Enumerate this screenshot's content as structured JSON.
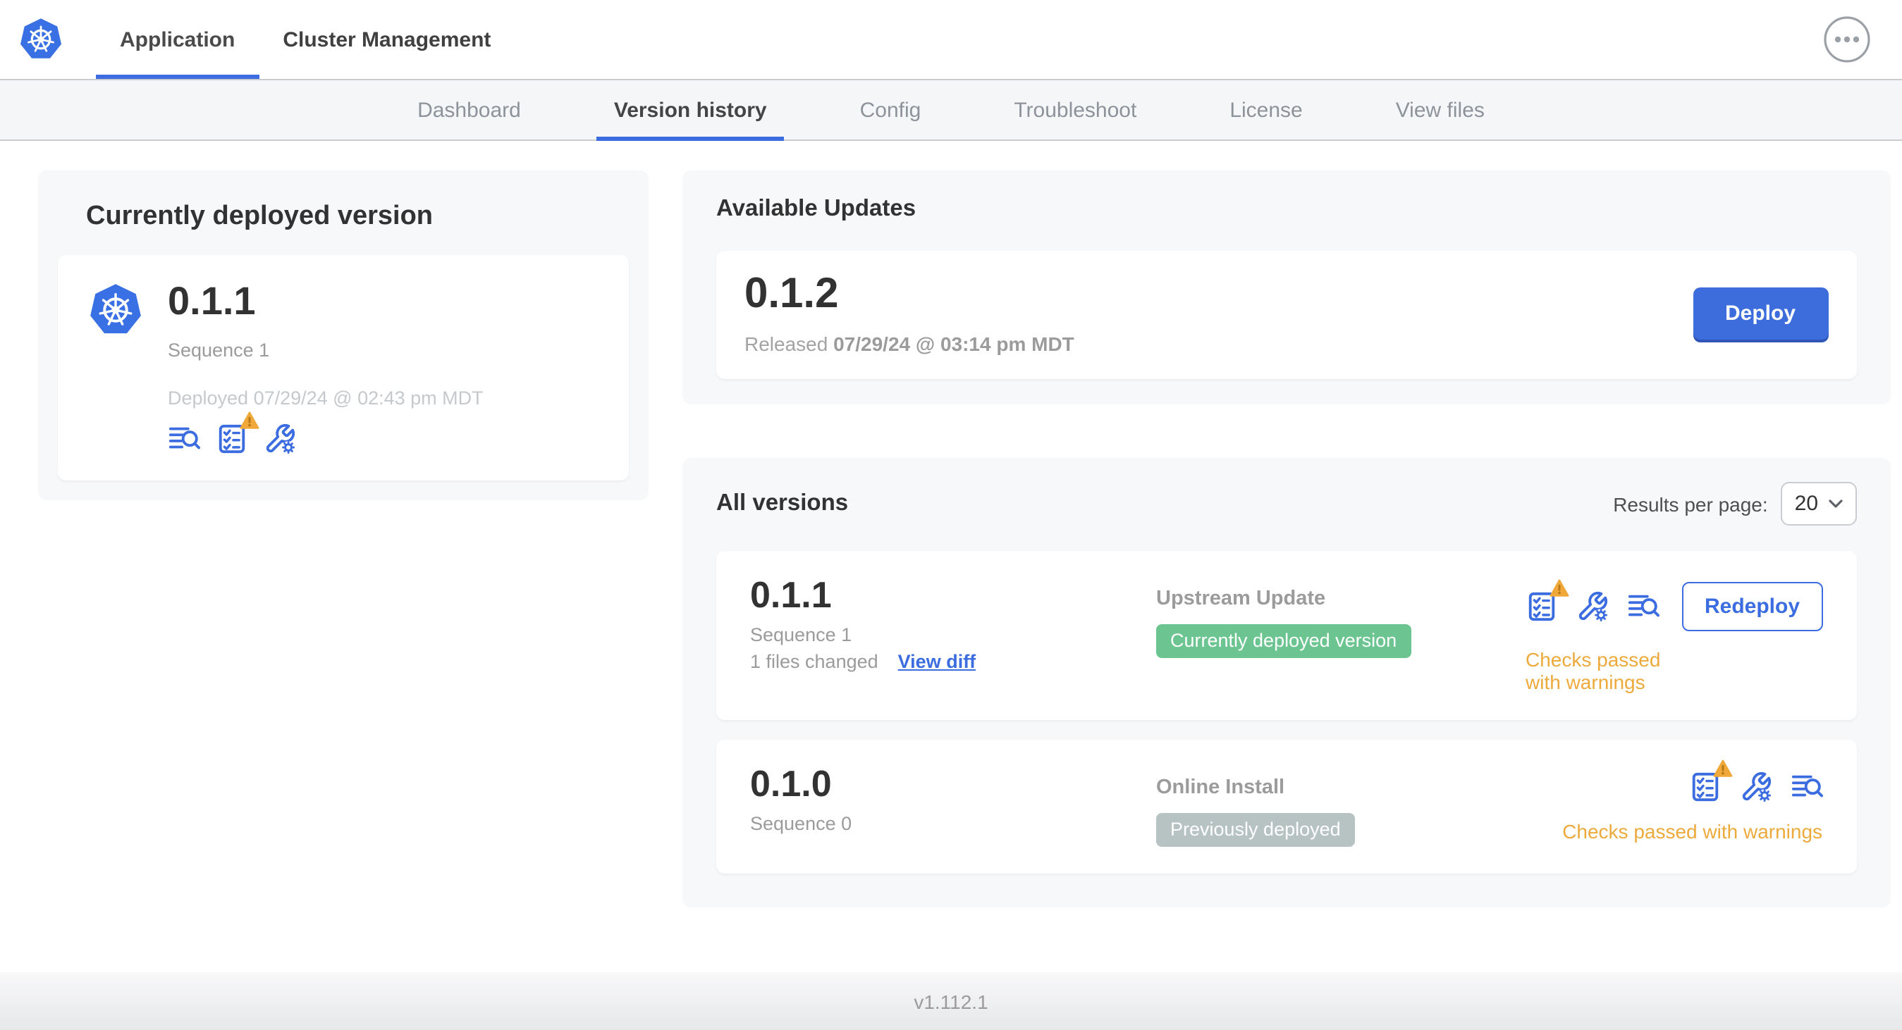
{
  "header": {
    "tabs": [
      {
        "label": "Application"
      },
      {
        "label": "Cluster Management"
      }
    ]
  },
  "subnav": {
    "items": [
      {
        "label": "Dashboard"
      },
      {
        "label": "Version history"
      },
      {
        "label": "Config"
      },
      {
        "label": "Troubleshoot"
      },
      {
        "label": "License"
      },
      {
        "label": "View files"
      }
    ],
    "active": "Version history"
  },
  "deployed_card": {
    "title": "Currently deployed version",
    "version": "0.1.1",
    "sequence": "Sequence 1",
    "deployed_at": "Deployed 07/29/24 @ 02:43 pm MDT"
  },
  "available_updates": {
    "title": "Available Updates",
    "version": "0.1.2",
    "released_label": "Released",
    "released_at": "07/29/24 @ 03:14 pm MDT",
    "deploy_label": "Deploy"
  },
  "all_versions": {
    "title": "All versions",
    "results_per_page_label": "Results per page:",
    "results_per_page_value": "20",
    "rows": [
      {
        "version": "0.1.1",
        "sequence": "Sequence 1",
        "files_changed": "1 files changed",
        "view_diff_label": "View diff",
        "source": "Upstream Update",
        "badge_label": "Currently deployed version",
        "badge_color": "#6cc591",
        "status_text": "Checks passed with warnings",
        "status_color": "#edaa3c",
        "action_label": "Redeploy"
      },
      {
        "version": "0.1.0",
        "sequence": "Sequence 0",
        "source": "Online Install",
        "badge_label": "Previously deployed",
        "badge_color": "#b7c2c3",
        "status_text": "Checks passed with warnings",
        "status_color": "#edaa3c"
      }
    ]
  },
  "footer": {
    "app_version": "v1.112.1"
  },
  "colors": {
    "accent_blue": "#3b6ce0",
    "button_blue": "#3d6ddc",
    "warning_orange": "#edaa3c",
    "badge_green": "#6cc591",
    "badge_gray": "#b7c2c3",
    "logo_blue": "#3970e4"
  }
}
